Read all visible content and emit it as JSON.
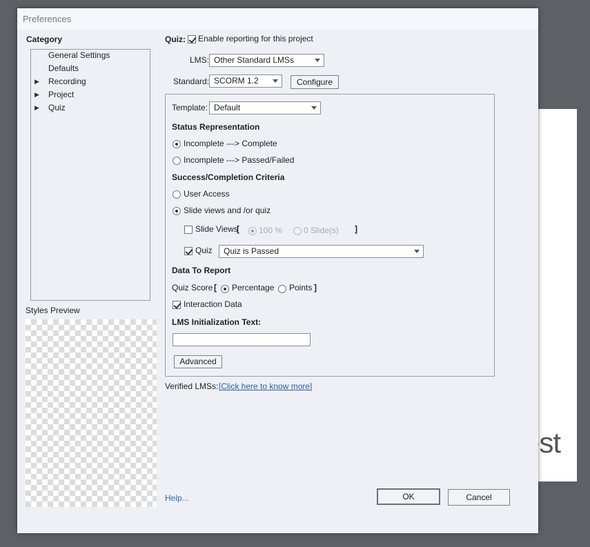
{
  "background": {
    "partial_text": "est"
  },
  "dialog": {
    "title": "Preferences",
    "category_label": "Category",
    "tree": [
      {
        "label": "General Settings",
        "expandable": false
      },
      {
        "label": "Defaults",
        "expandable": false
      },
      {
        "label": "Recording",
        "expandable": true
      },
      {
        "label": "Project",
        "expandable": true
      },
      {
        "label": "Quiz",
        "expandable": true
      }
    ],
    "styles_preview_label": "Styles Preview"
  },
  "quiz": {
    "label": "Quiz:",
    "enable_reporting_label": "Enable reporting for this project",
    "enable_reporting_checked": true,
    "lms_label": "LMS:",
    "lms_value": "Other Standard LMSs",
    "standard_label": "Standard:",
    "standard_value": "SCORM 1.2",
    "configure_button": "Configure",
    "template_label": "Template:",
    "template_value": "Default",
    "status_heading": "Status Representation",
    "status_options": [
      "Incomplete ---> Complete",
      "Incomplete ---> Passed/Failed"
    ],
    "status_selected_index": 0,
    "criteria_heading": "Success/Completion Criteria",
    "criteria_options": [
      "User Access",
      "Slide views and /or quiz"
    ],
    "criteria_selected_index": 1,
    "slide_views_label": "Slide Views",
    "slide_views_checked": false,
    "bracket_open": "[",
    "bracket_close": "]",
    "slide_percent": "100 %",
    "slide_count": "0 Slide(s)",
    "quiz_check_label": "Quiz",
    "quiz_check_checked": true,
    "quiz_condition_value": "Quiz is Passed",
    "data_heading": "Data To Report",
    "quiz_score_label": "Quiz Score",
    "score_percentage": "Percentage",
    "score_points": "Points",
    "interaction_data_label": "Interaction Data",
    "interaction_data_checked": true,
    "lms_init_label": "LMS Initialization Text:",
    "lms_init_value": "",
    "advanced_button": "Advanced",
    "verified_label": "Verified LMSs:",
    "verified_link": "[Click here to know more]"
  },
  "footer": {
    "help_link": "Help...",
    "ok_button": "OK",
    "cancel_button": "Cancel"
  }
}
